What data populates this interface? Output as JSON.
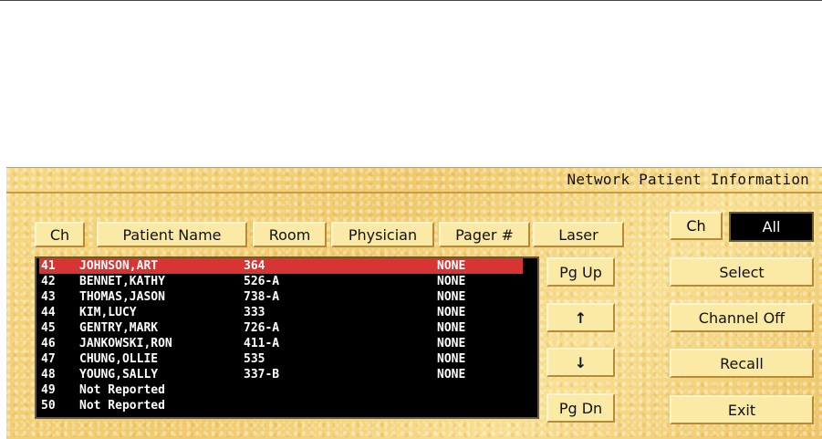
{
  "window": {
    "title": "Network Patient Information"
  },
  "columns": {
    "ch": "Ch",
    "patient_name": "Patient Name",
    "room": "Room",
    "physician": "Physician",
    "pager": "Pager #",
    "laser": "Laser"
  },
  "patients": [
    {
      "ch": "41",
      "name": "JOHNSON,ART",
      "room": "364",
      "pager": "NONE",
      "selected": true
    },
    {
      "ch": "42",
      "name": "BENNET,KATHY",
      "room": "526-A",
      "pager": "NONE"
    },
    {
      "ch": "43",
      "name": "THOMAS,JASON",
      "room": "738-A",
      "pager": "NONE"
    },
    {
      "ch": "44",
      "name": "KIM,LUCY",
      "room": "333",
      "pager": "NONE"
    },
    {
      "ch": "45",
      "name": "GENTRY,MARK",
      "room": "726-A",
      "pager": "NONE"
    },
    {
      "ch": "46",
      "name": "JANKOWSKI,RON",
      "room": "411-A",
      "pager": "NONE"
    },
    {
      "ch": "47",
      "name": "CHUNG,OLLIE",
      "room": "535",
      "pager": "NONE"
    },
    {
      "ch": "48",
      "name": "YOUNG,SALLY",
      "room": "337-B",
      "pager": "NONE"
    },
    {
      "ch": "49",
      "name": "Not Reported",
      "room": "",
      "pager": ""
    },
    {
      "ch": "50",
      "name": "Not Reported",
      "room": "",
      "pager": ""
    }
  ],
  "scroll": {
    "page_up": "Pg Up",
    "up_arrow": "↑",
    "down_arrow": "↓",
    "page_down": "Pg Dn"
  },
  "channel": {
    "label": "Ch",
    "value": "All"
  },
  "actions": {
    "select": "Select",
    "channel_off": "Channel Off",
    "recall": "Recall",
    "exit": "Exit"
  },
  "colors": {
    "panel": "#f3d37a",
    "button": "#fbe9a6",
    "selected_row": "#d93434",
    "list_background": "#000000"
  }
}
